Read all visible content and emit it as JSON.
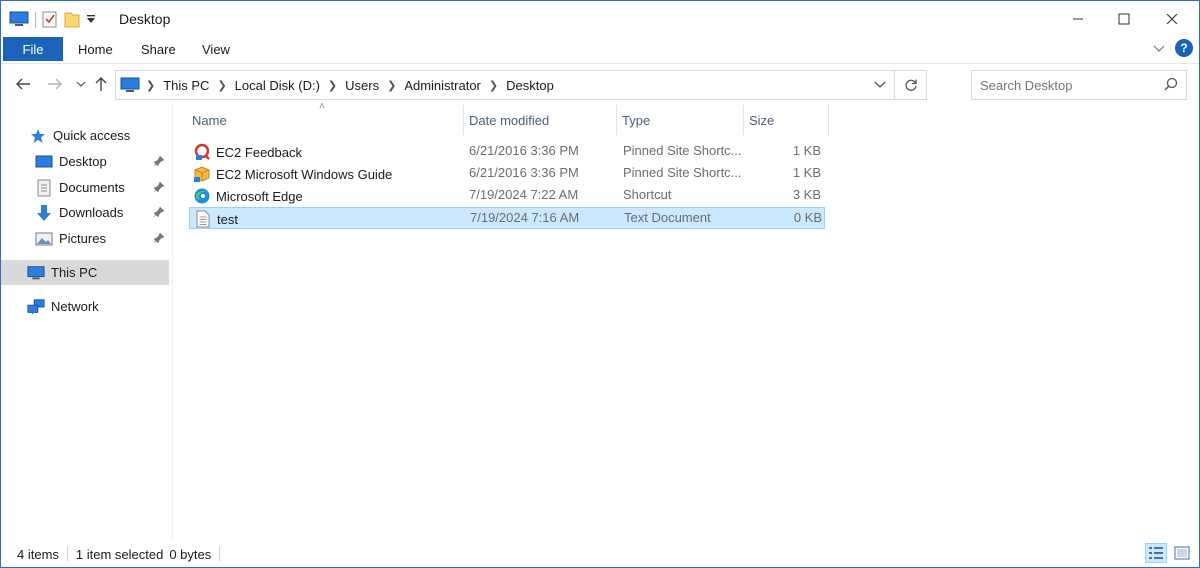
{
  "window": {
    "title": "Desktop",
    "controls": {
      "minimize": "minimize",
      "maximize": "maximize",
      "close": "close"
    }
  },
  "ribbon": {
    "tabs": [
      {
        "label": "File",
        "active": true
      },
      {
        "label": "Home"
      },
      {
        "label": "Share"
      },
      {
        "label": "View"
      }
    ]
  },
  "address": {
    "crumbs": [
      "This PC",
      "Local Disk (D:)",
      "Users",
      "Administrator",
      "Desktop"
    ]
  },
  "search": {
    "placeholder": "Search Desktop"
  },
  "sidebar": {
    "items": [
      {
        "label": "Quick access",
        "icon": "star-icon"
      },
      {
        "label": "Desktop",
        "icon": "desktop-icon",
        "pinned": true
      },
      {
        "label": "Documents",
        "icon": "documents-icon",
        "pinned": true
      },
      {
        "label": "Downloads",
        "icon": "download-arrow-icon",
        "pinned": true
      },
      {
        "label": "Pictures",
        "icon": "pictures-icon",
        "pinned": true
      },
      {
        "label": "This PC",
        "icon": "computer-icon",
        "selected": true
      },
      {
        "label": "Network",
        "icon": "network-icon"
      }
    ]
  },
  "columns": {
    "name": "Name",
    "date": "Date modified",
    "type": "Type",
    "size": "Size"
  },
  "files": [
    {
      "name": "EC2 Feedback",
      "date": "6/21/2016 3:36 PM",
      "type": "Pinned Site Shortc...",
      "size": "1 KB",
      "icon": "feedback-shortcut-icon"
    },
    {
      "name": "EC2 Microsoft Windows Guide",
      "date": "6/21/2016 3:36 PM",
      "type": "Pinned Site Shortc...",
      "size": "1 KB",
      "icon": "guide-shortcut-icon"
    },
    {
      "name": "Microsoft Edge",
      "date": "7/19/2024 7:22 AM",
      "type": "Shortcut",
      "size": "3 KB",
      "icon": "edge-icon"
    },
    {
      "name": "test",
      "date": "7/19/2024 7:16 AM",
      "type": "Text Document",
      "size": "0 KB",
      "icon": "text-file-icon",
      "selected": true
    }
  ],
  "status": {
    "count": "4 items",
    "selection": "1 item selected",
    "size": "0 bytes"
  },
  "colors": {
    "accent": "#1a63b8",
    "selection_bg": "#cce8ff",
    "selection_border": "#99d1ff",
    "header_text": "#4c607a"
  }
}
